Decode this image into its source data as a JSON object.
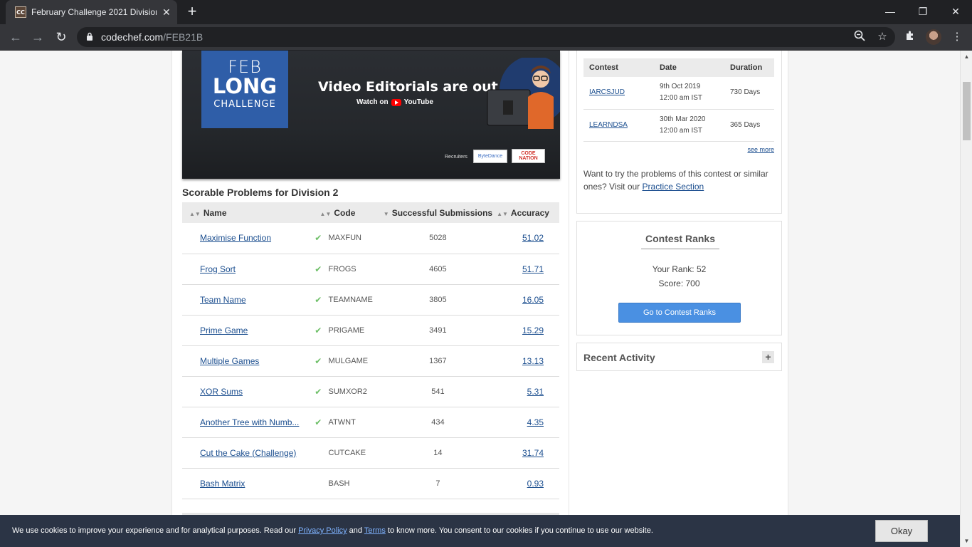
{
  "browser": {
    "tab_title": "February Challenge 2021 Division",
    "favicon_text": "CC",
    "url_host": "codechef.com",
    "url_path": "/FEB21B"
  },
  "banner": {
    "line1": "FEB",
    "line2": "LONG",
    "line3": "CHALLENGE",
    "headline": "Video Editorials are out",
    "watch_on": "Watch on",
    "youtube": "YouTube",
    "recruiters": "Recruiters",
    "sponsor1": "ByteDance",
    "sponsor2": "CODE NATION"
  },
  "problems": {
    "title": "Scorable Problems for Division 2",
    "headers": {
      "name": "Name",
      "code": "Code",
      "subs": "Successful Submissions",
      "accuracy": "Accuracy"
    },
    "rows": [
      {
        "name": "Maximise Function",
        "solved": true,
        "code": "MAXFUN",
        "subs": "5028",
        "accuracy": "51.02"
      },
      {
        "name": "Frog Sort",
        "solved": true,
        "code": "FROGS",
        "subs": "4605",
        "accuracy": "51.71"
      },
      {
        "name": "Team Name",
        "solved": true,
        "code": "TEAMNAME",
        "subs": "3805",
        "accuracy": "16.05"
      },
      {
        "name": "Prime Game",
        "solved": true,
        "code": "PRIGAME",
        "subs": "3491",
        "accuracy": "15.29"
      },
      {
        "name": "Multiple Games",
        "solved": true,
        "code": "MULGAME",
        "subs": "1367",
        "accuracy": "13.13"
      },
      {
        "name": "XOR Sums",
        "solved": true,
        "code": "SUMXOR2",
        "subs": "541",
        "accuracy": "5.31"
      },
      {
        "name": "Another Tree with Numb...",
        "solved": true,
        "code": "ATWNT",
        "subs": "434",
        "accuracy": "4.35"
      },
      {
        "name": "Cut the Cake (Challenge)",
        "solved": false,
        "code": "CUTCAKE",
        "subs": "14",
        "accuracy": "31.74"
      },
      {
        "name": "Bash Matrix",
        "solved": false,
        "code": "BASH",
        "subs": "7",
        "accuracy": "0.93"
      }
    ]
  },
  "contests": {
    "headers": {
      "contest": "Contest",
      "date": "Date",
      "duration": "Duration"
    },
    "rows": [
      {
        "code": "IARCSJUD",
        "date": "9th Oct 2019",
        "time": "12:00 am IST",
        "duration": "730 Days"
      },
      {
        "code": "LEARNDSA",
        "date": "30th Mar 2020",
        "time": "12:00 am IST",
        "duration": "365 Days"
      }
    ],
    "see_more": "see more",
    "practice_prefix": "Want to try the problems of this contest or similar ones? Visit our",
    "practice_link": "Practice Section"
  },
  "ranks": {
    "title": "Contest Ranks",
    "your_rank": "Your Rank: 52",
    "score": "Score: 700",
    "button": "Go to Contest Ranks"
  },
  "recent": {
    "title": "Recent Activity",
    "toggle": "+"
  },
  "cookie": {
    "before_privacy": "We use cookies to improve your experience and for analytical purposes. Read our",
    "privacy": "Privacy Policy",
    "and": "and",
    "terms": "Terms",
    "after_terms": "to know more. You consent to our cookies if you continue to use our website.",
    "okay": "Okay"
  }
}
